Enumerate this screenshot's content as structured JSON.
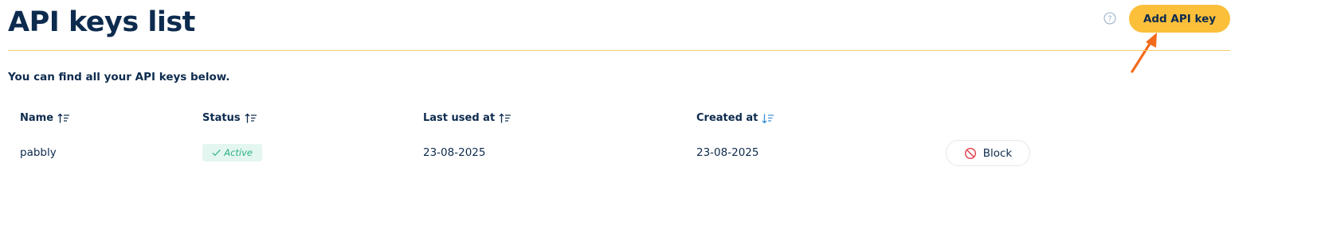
{
  "header": {
    "title": "API keys list",
    "add_button_label": "Add API key",
    "help_icon": "question-circle-icon",
    "accent_color": "#fbbf3a"
  },
  "subtitle": "You can find all your API keys below.",
  "table": {
    "columns": [
      {
        "label": "Name",
        "sort": "ascending",
        "sort_icon": "sort-ascending-icon"
      },
      {
        "label": "Status",
        "sort": "ascending",
        "sort_icon": "sort-ascending-icon"
      },
      {
        "label": "Last used at",
        "sort": "ascending",
        "sort_icon": "sort-ascending-icon"
      },
      {
        "label": "Created at",
        "sort": "descending",
        "sort_icon": "sort-descending-icon",
        "active": true
      }
    ],
    "rows": [
      {
        "name": "pabbly",
        "status": "Active",
        "status_color": "#2fb383",
        "last_used_at": "23-08-2025",
        "created_at": "23-08-2025",
        "action_label": "Block",
        "action_icon": "block-icon"
      }
    ]
  },
  "annotation": {
    "arrow_color": "#f26b1d",
    "arrow_icon": "pointer-arrow-icon"
  }
}
